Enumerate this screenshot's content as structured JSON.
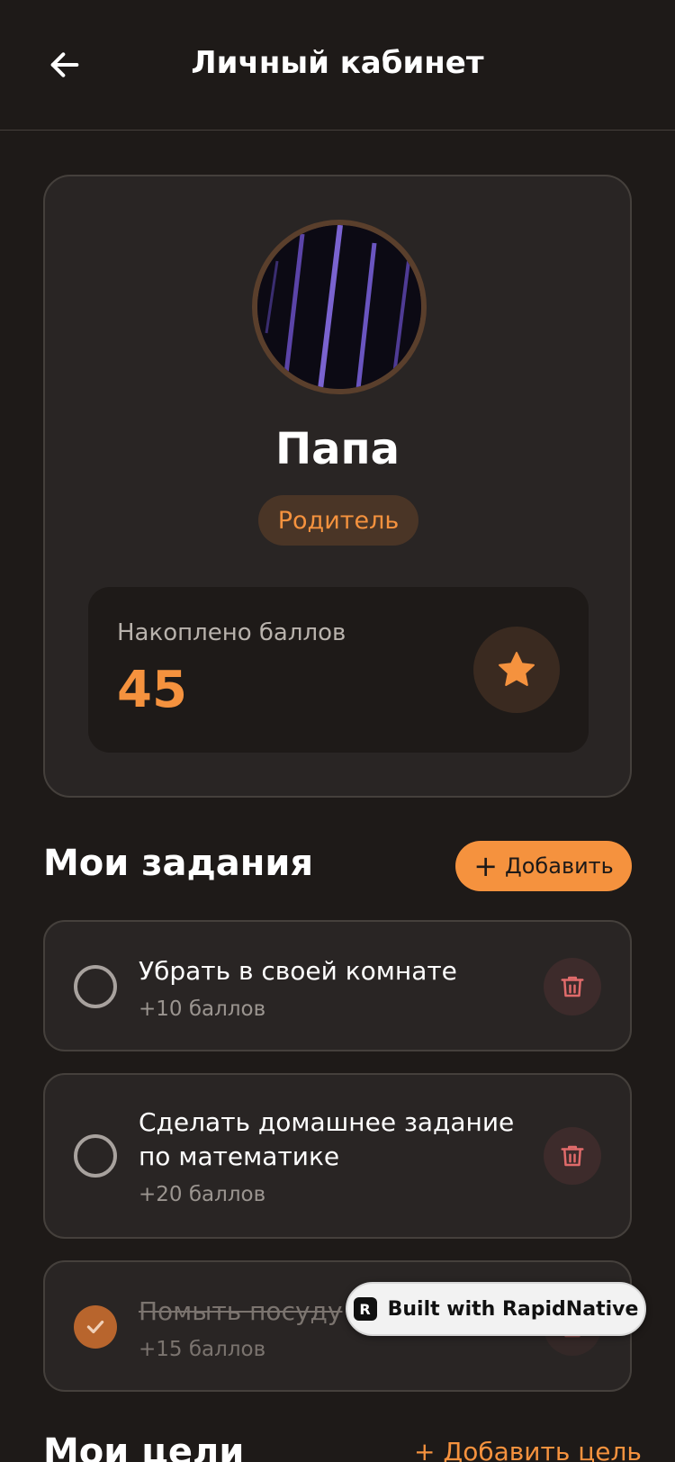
{
  "header": {
    "title": "Личный кабинет"
  },
  "profile": {
    "name": "Папа",
    "role": "Родитель",
    "points_label": "Накоплено баллов",
    "points_value": "45"
  },
  "tasks_section": {
    "title": "Мои задания",
    "add_label": "Добавить",
    "items": [
      {
        "title": "Убрать в своей комнате",
        "points": "+10 баллов",
        "done": false
      },
      {
        "title": "Сделать домашнее задание по математике",
        "points": "+20 баллов",
        "done": false
      },
      {
        "title": "Помыть посуду",
        "points": "+15 баллов",
        "done": true
      }
    ]
  },
  "goals_section": {
    "title": "Мои цели",
    "add_label": "Добавить цель"
  },
  "badge": {
    "label": "Built with RapidNative"
  },
  "colors": {
    "background": "#1e1a18",
    "card": "#292524",
    "accent": "#f5923e",
    "danger": "#e06b6b"
  }
}
